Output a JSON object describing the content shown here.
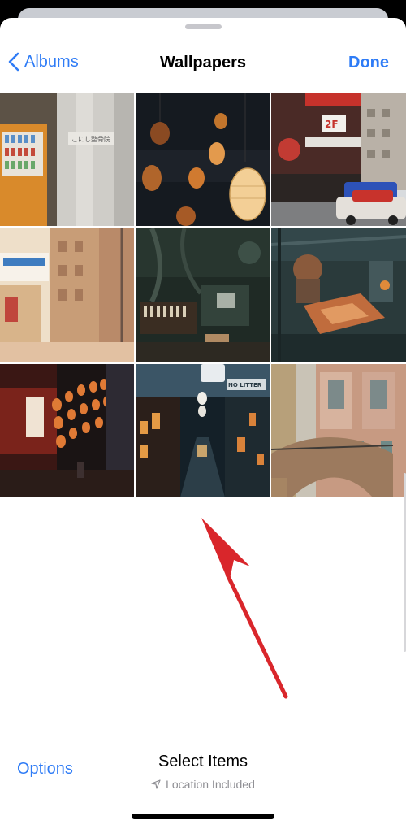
{
  "nav": {
    "back_label": "Albums",
    "title": "Wallpapers",
    "done_label": "Done"
  },
  "photos": [
    {
      "name": "vending-machine-street",
      "sign_text": "こにし整骨院"
    },
    {
      "name": "hanging-lanterns"
    },
    {
      "name": "tokyo-street-taxi",
      "sign_text": "2F"
    },
    {
      "name": "anime-alley"
    },
    {
      "name": "workshop-machinery"
    },
    {
      "name": "robot-workshop"
    },
    {
      "name": "red-lantern-alley"
    },
    {
      "name": "night-alley-no-litter",
      "sign_text": "NO LITTER"
    },
    {
      "name": "stone-bridge-building"
    }
  ],
  "toolbar": {
    "options_label": "Options",
    "title": "Select Items",
    "location_label": "Location Included"
  },
  "colors": {
    "accent": "#2f7cf6",
    "annotation_arrow": "#d9262b"
  }
}
